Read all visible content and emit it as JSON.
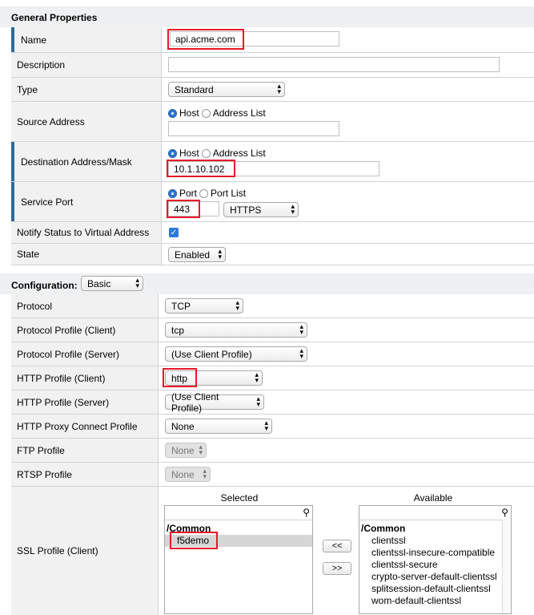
{
  "general": {
    "title": "General Properties",
    "name_label": "Name",
    "name_value": "api.acme.com",
    "description_label": "Description",
    "description_value": "",
    "type_label": "Type",
    "type_value": "Standard",
    "source_label": "Source Address",
    "source_opt_host": "Host",
    "source_opt_list": "Address List",
    "source_value": "",
    "dest_label": "Destination Address/Mask",
    "dest_opt_host": "Host",
    "dest_opt_list": "Address List",
    "dest_value": "10.1.10.102",
    "port_label": "Service Port",
    "port_opt_port": "Port",
    "port_opt_list": "Port List",
    "port_value": "443",
    "port_service": "HTTPS",
    "notify_label": "Notify Status to Virtual Address",
    "notify_checked": true,
    "state_label": "State",
    "state_value": "Enabled"
  },
  "config": {
    "title": "Configuration:",
    "mode_value": "Basic",
    "protocol_label": "Protocol",
    "protocol_value": "TCP",
    "pp_client_label": "Protocol Profile (Client)",
    "pp_client_value": "tcp",
    "pp_server_label": "Protocol Profile (Server)",
    "pp_server_value": "(Use Client Profile)",
    "http_client_label": "HTTP Profile (Client)",
    "http_client_value": "http",
    "http_server_label": "HTTP Profile (Server)",
    "http_server_value": "(Use Client Profile)",
    "http_proxy_label": "HTTP Proxy Connect Profile",
    "http_proxy_value": "None",
    "ftp_label": "FTP Profile",
    "ftp_value": "None",
    "rtsp_label": "RTSP Profile",
    "rtsp_value": "None",
    "ssl_label": "SSL Profile (Client)",
    "selected_header": "Selected",
    "available_header": "Available",
    "selected_group": "/Common",
    "selected_items": [
      "f5demo"
    ],
    "available_group": "/Common",
    "available_items": [
      "clientssl",
      "clientssl-insecure-compatible",
      "clientssl-secure",
      "crypto-server-default-clientssl",
      "splitsession-default-clientssl",
      "wom-default-clientssl"
    ],
    "move_left": "<<",
    "move_right": ">>"
  },
  "colors": {
    "highlight": "#e8182a",
    "accent_bar": "#2f6a97",
    "check": "#2c7ad6"
  }
}
